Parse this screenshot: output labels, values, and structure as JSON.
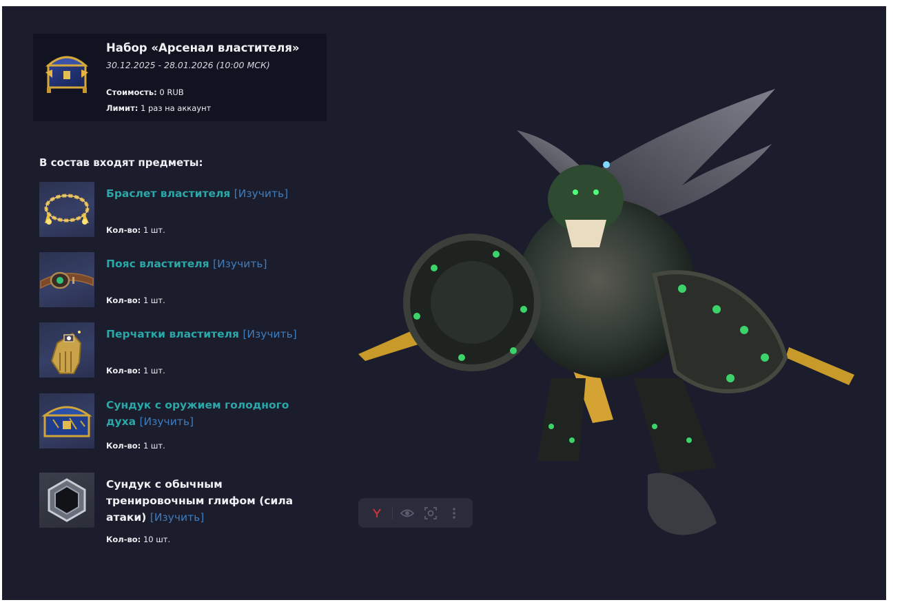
{
  "bundle": {
    "title": "Набор «Арсенал властителя»",
    "dates": "30.12.2025 - 28.01.2026 (10:00 МСК)",
    "cost_label": "Стоимость:",
    "cost_value": "0 RUB",
    "limit_label": "Лимит:",
    "limit_value": "1 раз на аккаунт",
    "thumb_icon": "treasure-chest-icon"
  },
  "contents": {
    "heading": "В состав входят предметы:",
    "qty_label": "Кол-во:",
    "study_link": "[Изучить]",
    "items": [
      {
        "name": "Браслет властителя",
        "qty": "1 шт.",
        "icon": "bracelet-icon",
        "color": "#2aa8a8"
      },
      {
        "name": "Пояс властителя",
        "qty": "1 шт.",
        "icon": "belt-icon",
        "color": "#2aa8a8"
      },
      {
        "name": "Перчатки властителя",
        "qty": "1 шт.",
        "icon": "gloves-icon",
        "color": "#2aa8a8"
      },
      {
        "name": "Сундук с оружием голодного духа",
        "qty": "1 шт.",
        "icon": "chest-icon",
        "color": "#2aa8a8"
      },
      {
        "name": "Сундук с обычным тренировочным глифом (сила атаки)",
        "qty": "10 шт.",
        "icon": "glyph-icon",
        "color": "#f0f0f4"
      }
    ]
  },
  "toolbar": {
    "buttons": [
      "yandex-icon",
      "eye-icon",
      "screenshot-icon",
      "more-icon"
    ]
  },
  "colors": {
    "panel_bg": "#1b1c2c",
    "card_bg": "#121320",
    "item_name_accent": "#2aa8a8",
    "link": "#3f7dbd"
  }
}
